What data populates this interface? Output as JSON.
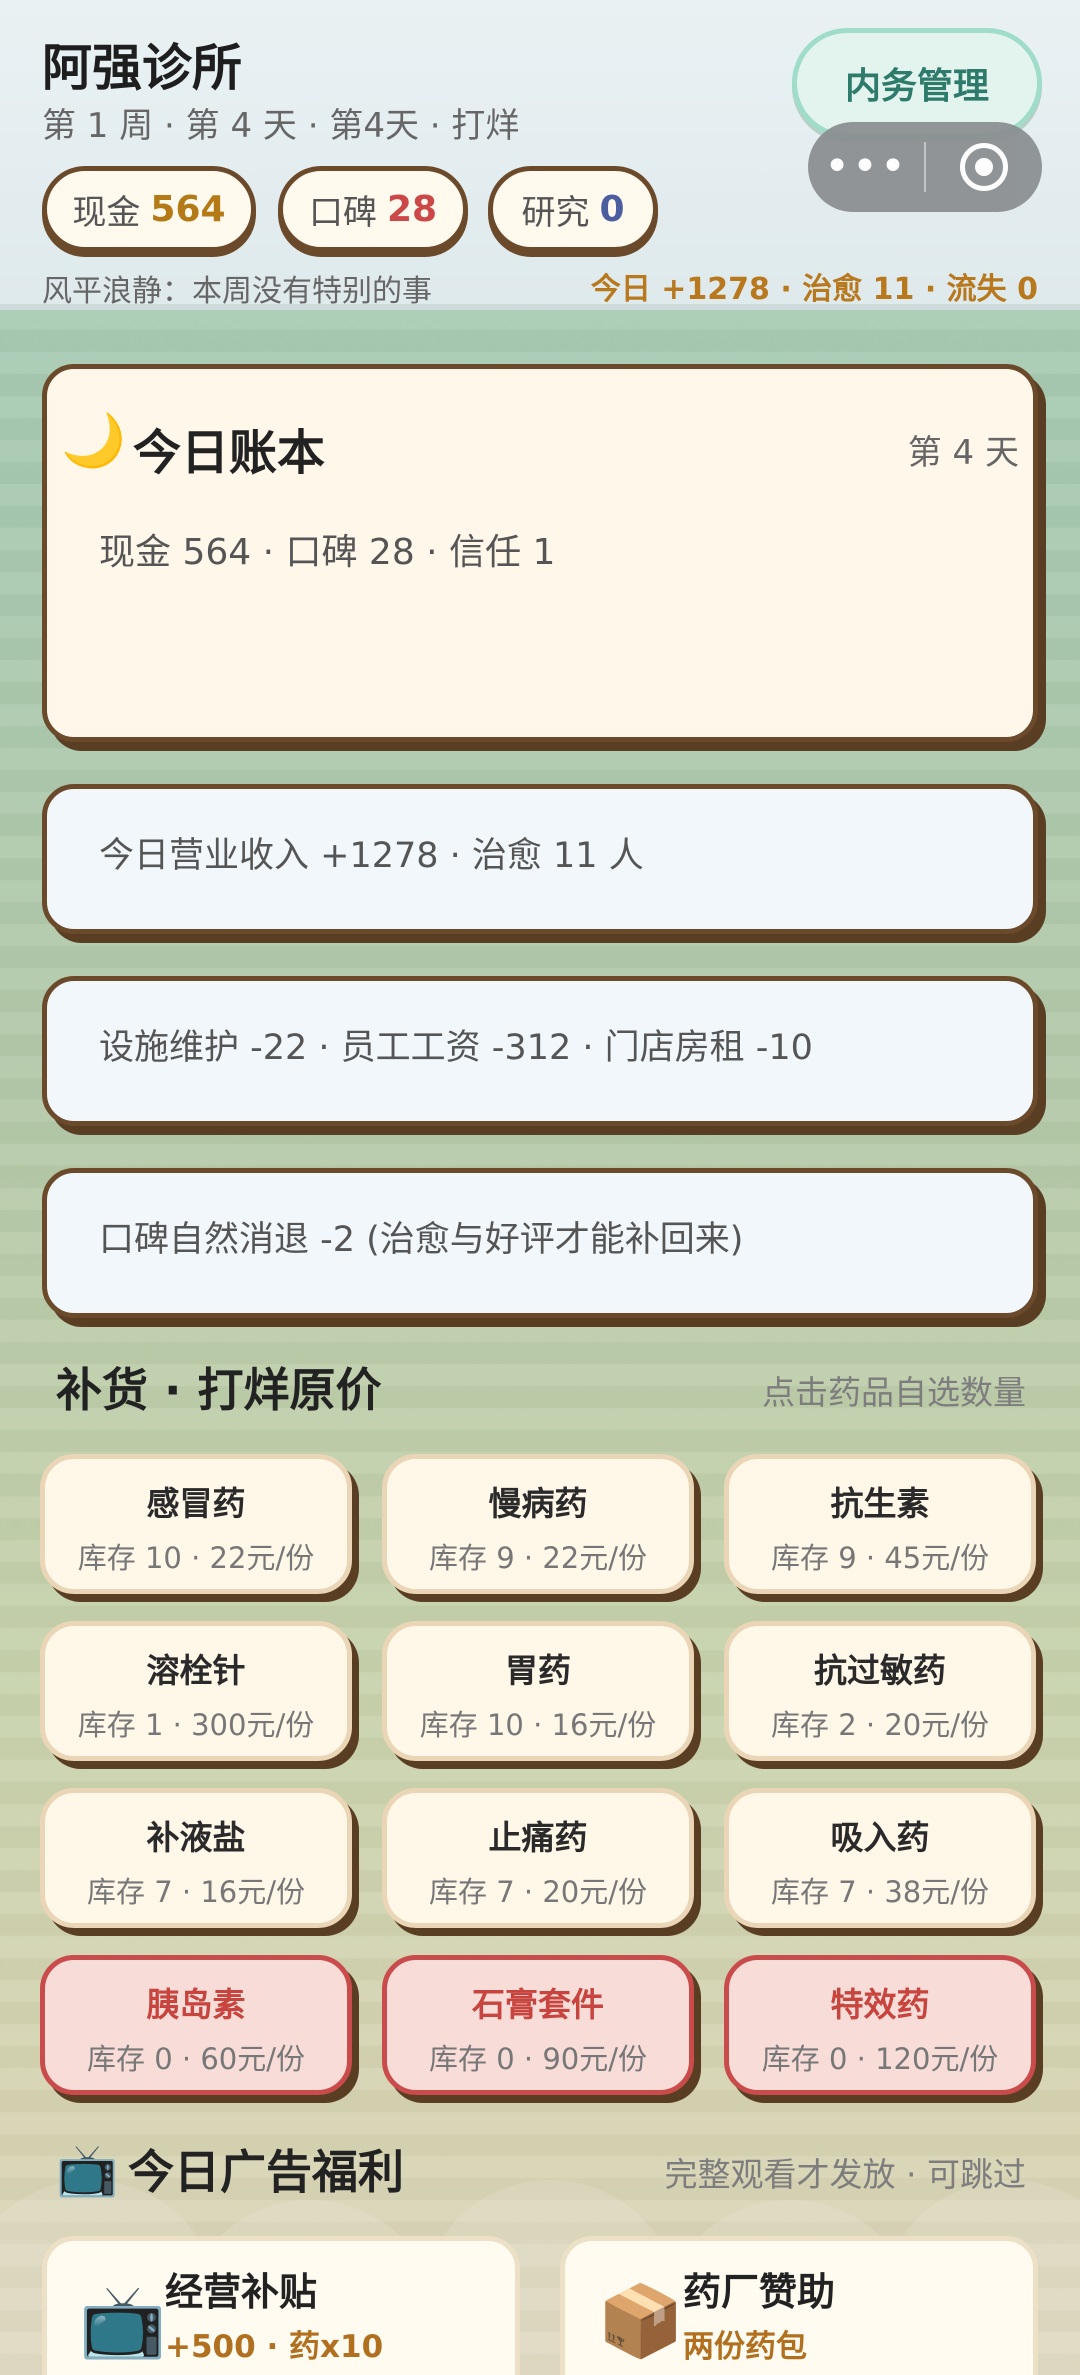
{
  "header": {
    "clinic_name": "阿强诊所",
    "week_line": "第 1 周 · 第 4 天 · 第4天 · 打烊",
    "inner_button": "内务管理",
    "capsule_more": "•••",
    "stats": {
      "cash_label": "现金",
      "cash_value": "564",
      "rep_label": "口碑",
      "rep_value": "28",
      "research_label": "研究",
      "research_value": "0"
    },
    "event": "风平浪静：本周没有特别的事",
    "today_summary": "今日 +1278 · 治愈 11 · 流失 0"
  },
  "colors": {
    "cash": "#b47a16",
    "reputation": "#cc4848",
    "research": "#4a5ea0"
  },
  "ledger": {
    "icon": "moon-icon",
    "title": "今日账本",
    "day": "第 4 天",
    "summary": "现金 564 · 口碑 28 · 信任 1"
  },
  "info_cards": [
    "今日营业收入 +1278 · 治愈 11 人",
    "设施维护 -22 · 员工工资 -312 · 门店房租 -10",
    "口碑自然消退 -2 (治愈与好评才能补回来)"
  ],
  "restock": {
    "title": "补货 · 打烊原价",
    "hint": "点击药品自选数量",
    "items": [
      {
        "name": "感冒药",
        "meta": "库存 10 · 22元/份"
      },
      {
        "name": "慢病药",
        "meta": "库存 9 · 22元/份"
      },
      {
        "name": "抗生素",
        "meta": "库存 9 · 45元/份"
      },
      {
        "name": "溶栓针",
        "meta": "库存 1 · 300元/份"
      },
      {
        "name": "胃药",
        "meta": "库存 10 · 16元/份"
      },
      {
        "name": "抗过敏药",
        "meta": "库存 2 · 20元/份"
      },
      {
        "name": "补液盐",
        "meta": "库存 7 · 16元/份"
      },
      {
        "name": "止痛药",
        "meta": "库存 7 · 20元/份"
      },
      {
        "name": "吸入药",
        "meta": "库存 7 · 38元/份"
      },
      {
        "name": "胰岛素",
        "meta": "库存 0 · 60元/份"
      },
      {
        "name": "石膏套件",
        "meta": "库存 0 · 90元/份"
      },
      {
        "name": "特效药",
        "meta": "库存 0 · 120元/份"
      }
    ]
  },
  "ads": {
    "icon": "tv-icon",
    "title": "今日广告福利",
    "hint": "完整观看才发放 · 可跳过",
    "cards": [
      {
        "icon": "tv-icon",
        "title": "经营补贴",
        "sub": "+500 · 药x10"
      },
      {
        "icon": "package-icon",
        "title": "药厂赞助",
        "sub": "两份药包"
      }
    ]
  }
}
